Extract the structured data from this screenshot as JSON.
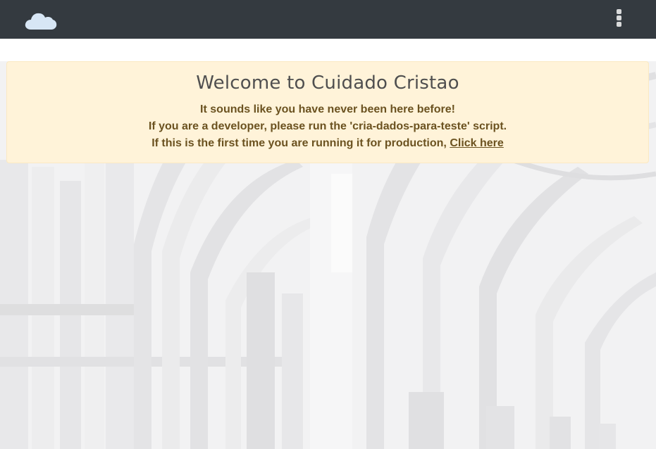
{
  "navbar": {
    "brand_icon": "cloud-icon",
    "menu_icon": "kebab-menu-icon",
    "background_color": "#343a40"
  },
  "welcome": {
    "title": "Welcome to Cuidado Cristao",
    "line1": "It sounds like you have never been here before!",
    "line2": "If you are a developer, please run the 'cria-dados-para-teste' script.",
    "line3_prefix": "If this is the first time you are running it for production, ",
    "link_label": "Click here",
    "background_color": "#fff3d9",
    "text_color": "#6b5220"
  },
  "background": {
    "image": "cloister-arches-photo"
  }
}
